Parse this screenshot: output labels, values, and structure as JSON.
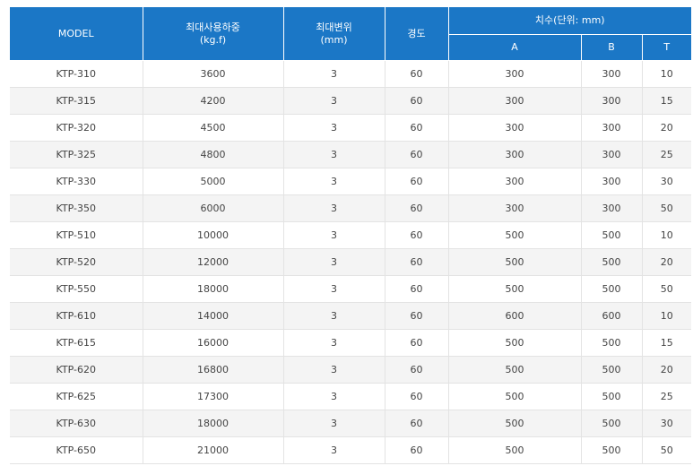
{
  "headers": {
    "model": "MODEL",
    "load_line1": "최대사용하중",
    "load_line2": "(kg.f)",
    "disp_line1": "최대변위",
    "disp_line2": "(mm)",
    "hardness": "경도",
    "dims": "치수(단위: mm)",
    "a": "A",
    "b": "B",
    "t": "T"
  },
  "rows": [
    [
      "KTP-310",
      "3600",
      "3",
      "60",
      "300",
      "300",
      "10"
    ],
    [
      "KTP-315",
      "4200",
      "3",
      "60",
      "300",
      "300",
      "15"
    ],
    [
      "KTP-320",
      "4500",
      "3",
      "60",
      "300",
      "300",
      "20"
    ],
    [
      "KTP-325",
      "4800",
      "3",
      "60",
      "300",
      "300",
      "25"
    ],
    [
      "KTP-330",
      "5000",
      "3",
      "60",
      "300",
      "300",
      "30"
    ],
    [
      "KTP-350",
      "6000",
      "3",
      "60",
      "300",
      "300",
      "50"
    ],
    [
      "KTP-510",
      "10000",
      "3",
      "60",
      "500",
      "500",
      "10"
    ],
    [
      "KTP-520",
      "12000",
      "3",
      "60",
      "500",
      "500",
      "20"
    ],
    [
      "KTP-550",
      "18000",
      "3",
      "60",
      "500",
      "500",
      "50"
    ],
    [
      "KTP-610",
      "14000",
      "3",
      "60",
      "600",
      "600",
      "10"
    ],
    [
      "KTP-615",
      "16000",
      "3",
      "60",
      "500",
      "500",
      "15"
    ],
    [
      "KTP-620",
      "16800",
      "3",
      "60",
      "500",
      "500",
      "20"
    ],
    [
      "KTP-625",
      "17300",
      "3",
      "60",
      "500",
      "500",
      "25"
    ],
    [
      "KTP-630",
      "18000",
      "3",
      "60",
      "500",
      "500",
      "30"
    ],
    [
      "KTP-650",
      "21000",
      "3",
      "60",
      "500",
      "500",
      "50"
    ]
  ],
  "colors": {
    "header_bg": "#1b77c6",
    "header_text": "#ffffff",
    "stripe": "#f4f4f4",
    "grid": "#e3e3e3"
  }
}
